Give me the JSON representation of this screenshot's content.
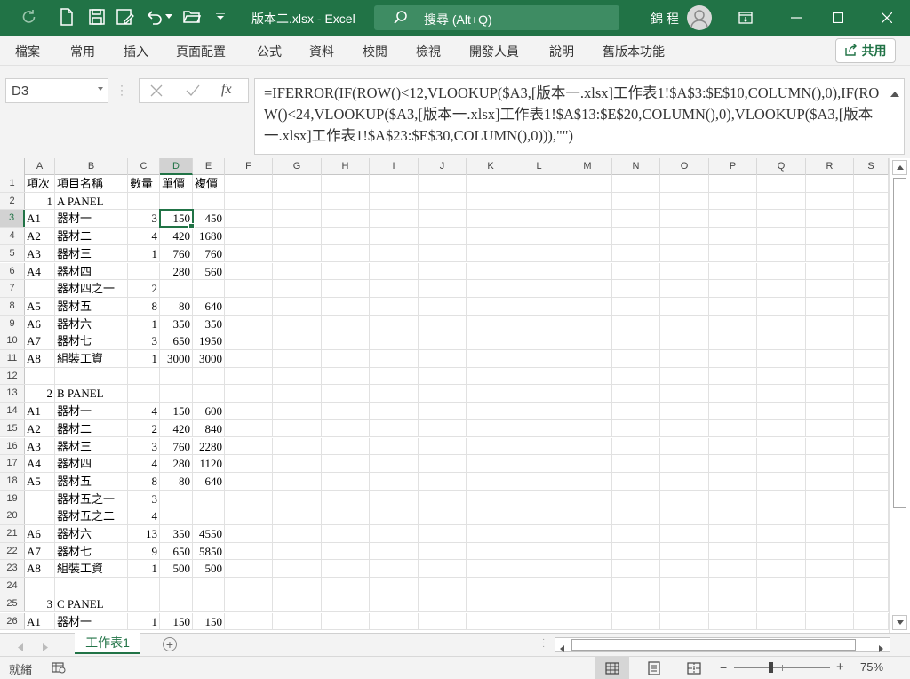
{
  "titlebar": {
    "document_title": "版本二.xlsx  -  Excel",
    "search_text": "搜尋 (Alt+Q)",
    "user_name": "錦 程"
  },
  "ribbon": {
    "tabs": [
      "檔案",
      "常用",
      "插入",
      "頁面配置",
      "公式",
      "資料",
      "校閱",
      "檢視",
      "開發人員",
      "說明",
      "舊版本功能"
    ],
    "share_label": "共用"
  },
  "formula_bar": {
    "name_box": "D3",
    "fx_label": "fx",
    "formula": "=IFERROR(IF(ROW()<12,VLOOKUP($A3,[版本一.xlsx]工作表1!$A$3:$E$10,COLUMN(),0),IF(ROW()<24,VLOOKUP($A3,[版本一.xlsx]工作表1!$A$13:$E$20,COLUMN(),0),VLOOKUP($A3,[版本一.xlsx]工作表1!$A$23:$E$30,COLUMN(),0))),\"\")"
  },
  "grid": {
    "columns": [
      "A",
      "B",
      "C",
      "D",
      "E",
      "F",
      "G",
      "H",
      "I",
      "J",
      "K",
      "L",
      "M",
      "N",
      "O",
      "P",
      "Q",
      "R",
      "S"
    ],
    "active_cell": "D3",
    "rows": [
      {
        "n": "1",
        "a": "項次",
        "b": "項目名稱",
        "c": "數量",
        "d": "單價",
        "e": "複價"
      },
      {
        "n": "2",
        "a": "1",
        "b": "A PANEL",
        "c": "",
        "d": "",
        "e": ""
      },
      {
        "n": "3",
        "a": "A1",
        "b": "器材一",
        "c": "3",
        "d": "150",
        "e": "450"
      },
      {
        "n": "4",
        "a": "A2",
        "b": "器材二",
        "c": "4",
        "d": "420",
        "e": "1680"
      },
      {
        "n": "5",
        "a": "A3",
        "b": "器材三",
        "c": "1",
        "d": "760",
        "e": "760"
      },
      {
        "n": "6",
        "a": "A4",
        "b": "器材四",
        "c": "",
        "d": "280",
        "e": "560"
      },
      {
        "n": "7",
        "a": "",
        "b": "器材四之一",
        "c": "2",
        "d": "",
        "e": ""
      },
      {
        "n": "8",
        "a": "A5",
        "b": "器材五",
        "c": "8",
        "d": "80",
        "e": "640"
      },
      {
        "n": "9",
        "a": "A6",
        "b": "器材六",
        "c": "1",
        "d": "350",
        "e": "350"
      },
      {
        "n": "10",
        "a": "A7",
        "b": "器材七",
        "c": "3",
        "d": "650",
        "e": "1950"
      },
      {
        "n": "11",
        "a": "A8",
        "b": "組裝工資",
        "c": "1",
        "d": "3000",
        "e": "3000"
      },
      {
        "n": "12",
        "a": "",
        "b": "",
        "c": "",
        "d": "",
        "e": ""
      },
      {
        "n": "13",
        "a": "2",
        "b": "B PANEL",
        "c": "",
        "d": "",
        "e": ""
      },
      {
        "n": "14",
        "a": "A1",
        "b": "器材一",
        "c": "4",
        "d": "150",
        "e": "600"
      },
      {
        "n": "15",
        "a": "A2",
        "b": "器材二",
        "c": "2",
        "d": "420",
        "e": "840"
      },
      {
        "n": "16",
        "a": "A3",
        "b": "器材三",
        "c": "3",
        "d": "760",
        "e": "2280"
      },
      {
        "n": "17",
        "a": "A4",
        "b": "器材四",
        "c": "4",
        "d": "280",
        "e": "1120"
      },
      {
        "n": "18",
        "a": "A5",
        "b": "器材五",
        "c": "8",
        "d": "80",
        "e": "640"
      },
      {
        "n": "19",
        "a": "",
        "b": "器材五之一",
        "c": "3",
        "d": "",
        "e": ""
      },
      {
        "n": "20",
        "a": "",
        "b": "器材五之二",
        "c": "4",
        "d": "",
        "e": ""
      },
      {
        "n": "21",
        "a": "A6",
        "b": "器材六",
        "c": "13",
        "d": "350",
        "e": "4550"
      },
      {
        "n": "22",
        "a": "A7",
        "b": "器材七",
        "c": "9",
        "d": "650",
        "e": "5850"
      },
      {
        "n": "23",
        "a": "A8",
        "b": "組裝工資",
        "c": "1",
        "d": "500",
        "e": "500"
      },
      {
        "n": "24",
        "a": "",
        "b": "",
        "c": "",
        "d": "",
        "e": ""
      },
      {
        "n": "25",
        "a": "3",
        "b": "C PANEL",
        "c": "",
        "d": "",
        "e": ""
      },
      {
        "n": "26",
        "a": "A1",
        "b": "器材一",
        "c": "1",
        "d": "150",
        "e": "150"
      }
    ]
  },
  "sheet_tabs": {
    "active": "工作表1",
    "add_label": "+"
  },
  "statusbar": {
    "status": "就緒",
    "zoom": "75%"
  },
  "colors": {
    "accent": "#217346",
    "grid_line": "#e1e1e1",
    "header_bg": "#f3f3f3"
  }
}
